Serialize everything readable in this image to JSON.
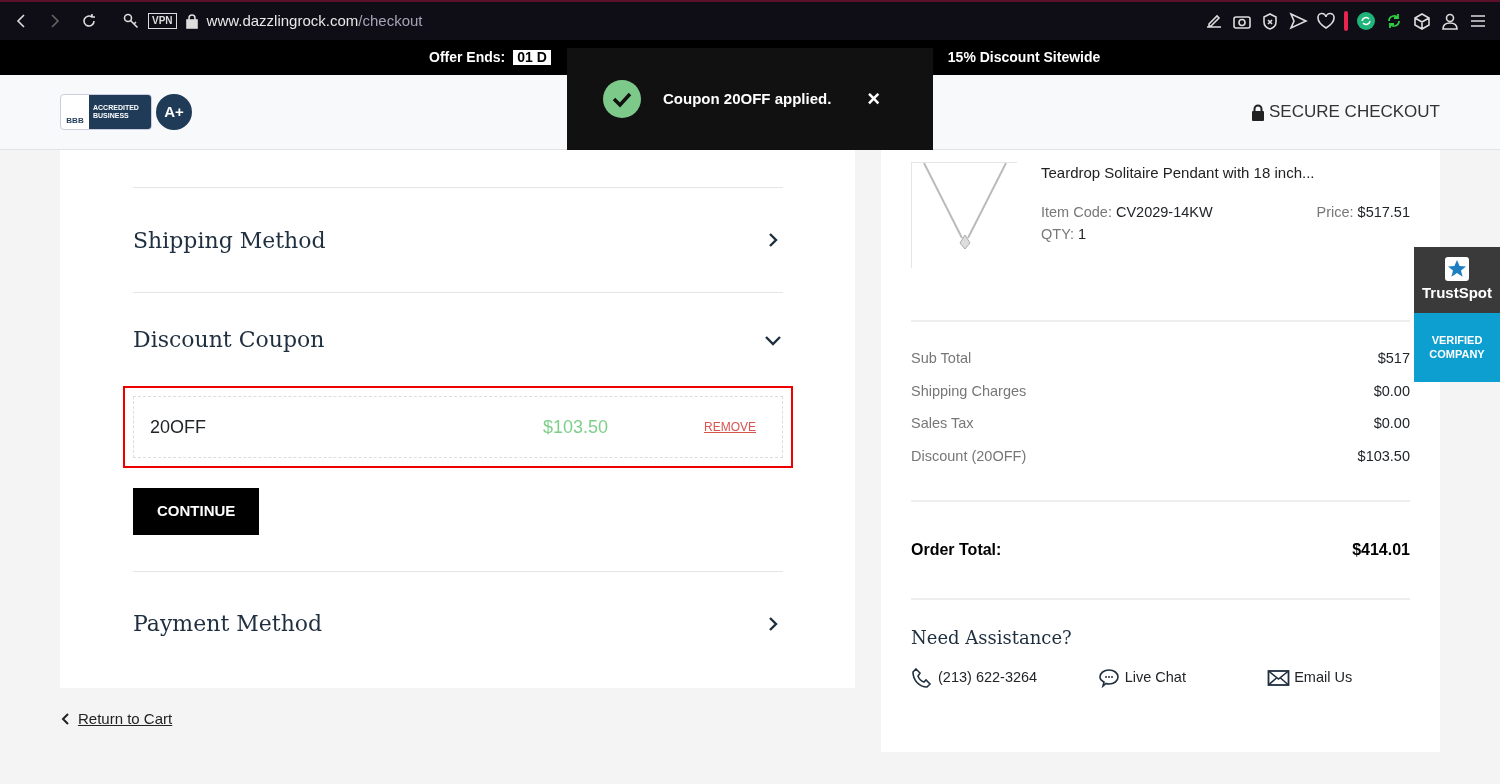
{
  "browser": {
    "url_host": "www.dazzlingrock.com",
    "url_path": "/checkout",
    "vpn_label": "VPN"
  },
  "offer_banner": {
    "label": "Offer Ends:",
    "timer": "01 D",
    "tail": "15% Discount Sitewide"
  },
  "header": {
    "bbb_text": "BBB",
    "bbb_label": "ACCREDITED BUSINESS",
    "rating": "A+",
    "secure_label": "SECURE CHECKOUT"
  },
  "toast": {
    "message": "Coupon 20OFF applied.",
    "close": "×"
  },
  "steps": [
    {
      "title": "Shipping Method",
      "expanded": false
    },
    {
      "title": "Discount Coupon",
      "expanded": true
    },
    {
      "title": "Payment Method",
      "expanded": false
    }
  ],
  "coupon": {
    "code": "20OFF",
    "amount": "$103.50",
    "remove": "REMOVE",
    "continue": "CONTINUE"
  },
  "return_link": "Return to Cart",
  "product": {
    "title": "Teardrop Solitaire Pendant with 18 inch...",
    "code_label": "Item Code:",
    "code": "CV2029-14KW",
    "price_label": "Price:",
    "price": "$517.51",
    "qty_label": "QTY:",
    "qty": "1"
  },
  "summary": [
    {
      "label": "Sub Total",
      "value": "$517"
    },
    {
      "label": "Shipping Charges",
      "value": "$0.00"
    },
    {
      "label": "Sales Tax",
      "value": "$0.00"
    },
    {
      "label": "Discount (20OFF)",
      "value": "$103.50"
    }
  ],
  "total": {
    "label": "Order Total:",
    "value": "$414.01"
  },
  "assistance": {
    "title": "Need Assistance?",
    "contacts": [
      {
        "kind": "phone",
        "label": "(213) 622-3264"
      },
      {
        "kind": "chat",
        "label": "Live Chat"
      },
      {
        "kind": "email",
        "label": "Email Us"
      }
    ]
  },
  "trustspot": {
    "name": "TrustSpot",
    "badge": "VERIFIED COMPANY"
  }
}
